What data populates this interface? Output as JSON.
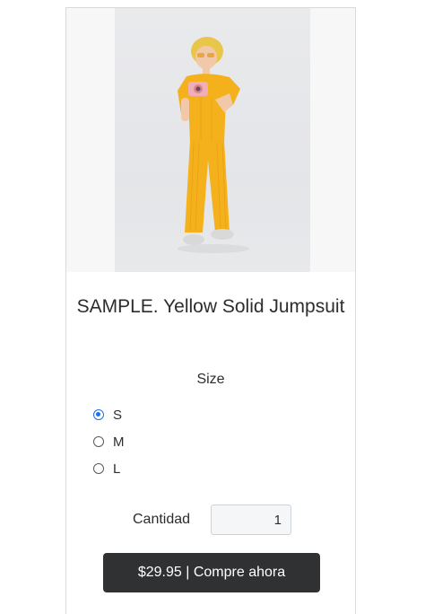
{
  "product": {
    "image_alt": "Yellow jumpsuit product photo",
    "title": "SAMPLE. Yellow Solid Jumpsuit"
  },
  "size": {
    "label": "Size",
    "options": [
      "S",
      "M",
      "L"
    ],
    "selected": "S"
  },
  "quantity": {
    "label": "Cantidad",
    "value": "1"
  },
  "buy_button": {
    "label": "$29.95 | Compre ahora"
  },
  "colors": {
    "button_bg": "#2f3133",
    "radio_accent": "#1a73e8",
    "jumpsuit": "#f4b11c"
  }
}
